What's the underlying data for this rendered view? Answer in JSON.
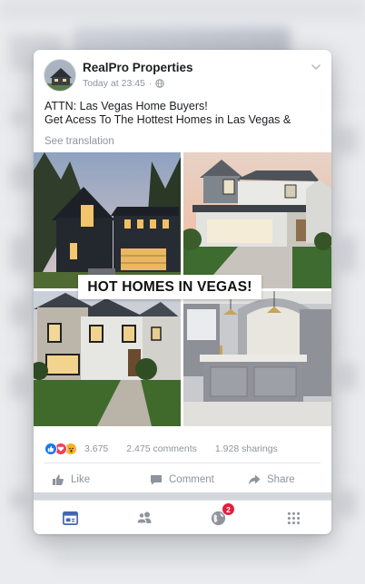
{
  "post": {
    "author": "RealPro Properties",
    "timestamp": "Today at 23:45",
    "text_line1": "ATTN: Las Vegas Home Buyers!",
    "text_line2": "Get Acess To The Hottest Homes in Las Vegas &",
    "see_translation": "See translation",
    "banner": "HOT HOMES IN VEGAS!"
  },
  "stats": {
    "reactions_count": "3.675",
    "comments": "2.475 comments",
    "shares": "1.928 sharings"
  },
  "actions": {
    "like": "Like",
    "comment": "Comment",
    "share": "Share"
  },
  "tabbar": {
    "notifications_badge": "2"
  },
  "colors": {
    "accent": "#4267b2",
    "badge": "#e41e3f",
    "muted": "#8d949e"
  },
  "icons": [
    "globe-icon",
    "chevron-down-icon",
    "like-icon",
    "comment-icon",
    "share-icon",
    "feed-icon",
    "friends-icon",
    "notifications-globe-icon",
    "menu-grid-icon"
  ]
}
